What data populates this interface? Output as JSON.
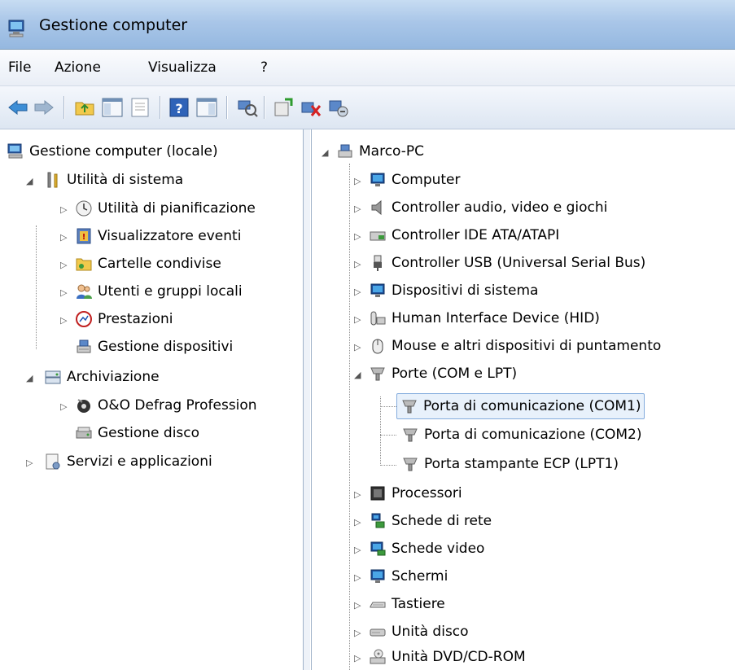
{
  "window": {
    "title": "Gestione computer"
  },
  "menu": {
    "file": "File",
    "action": "Azione",
    "view": "Visualizza",
    "help": "?"
  },
  "toolbar": {
    "icons": [
      "back-arrow-icon",
      "forward-arrow-icon",
      "folder-up-icon",
      "console-tree-icon",
      "properties-icon",
      "help-icon",
      "action-pane-icon",
      "scan-hardware-icon",
      "update-driver-icon",
      "uninstall-device-icon",
      "disable-device-icon"
    ]
  },
  "left_tree": {
    "root": "Gestione computer (locale)",
    "system_tools": "Utilità di sistema",
    "task_scheduler": "Utilità di pianificazione",
    "event_viewer": "Visualizzatore eventi",
    "shared_folders": "Cartelle condivise",
    "local_users": "Utenti e gruppi locali",
    "performance": "Prestazioni",
    "device_manager": "Gestione dispositivi",
    "storage": "Archiviazione",
    "defrag": "O&O Defrag Profession",
    "disk_management": "Gestione disco",
    "services_apps": "Servizi e applicazioni"
  },
  "right_tree": {
    "root": "Marco-PC",
    "computer": "Computer",
    "audio": "Controller audio, video e giochi",
    "ide": "Controller IDE ATA/ATAPI",
    "usb": "Controller USB (Universal Serial Bus)",
    "system_devices": "Dispositivi di sistema",
    "hid": "Human Interface Device (HID)",
    "mouse": "Mouse e altri dispositivi di puntamento",
    "ports": "Porte (COM e LPT)",
    "com1": "Porta di comunicazione (COM1)",
    "com2": "Porta di comunicazione (COM2)",
    "lpt1": "Porta stampante ECP (LPT1)",
    "processors": "Processori",
    "network": "Schede di rete",
    "video": "Schede video",
    "monitors": "Schermi",
    "keyboards": "Tastiere",
    "disk_drives": "Unità disco",
    "dvd": "Unità DVD/CD-ROM"
  },
  "colors": {
    "selection_bg": "#e8f1fb",
    "selection_border": "#84acdd",
    "titlebar": "#a9c6e8"
  }
}
